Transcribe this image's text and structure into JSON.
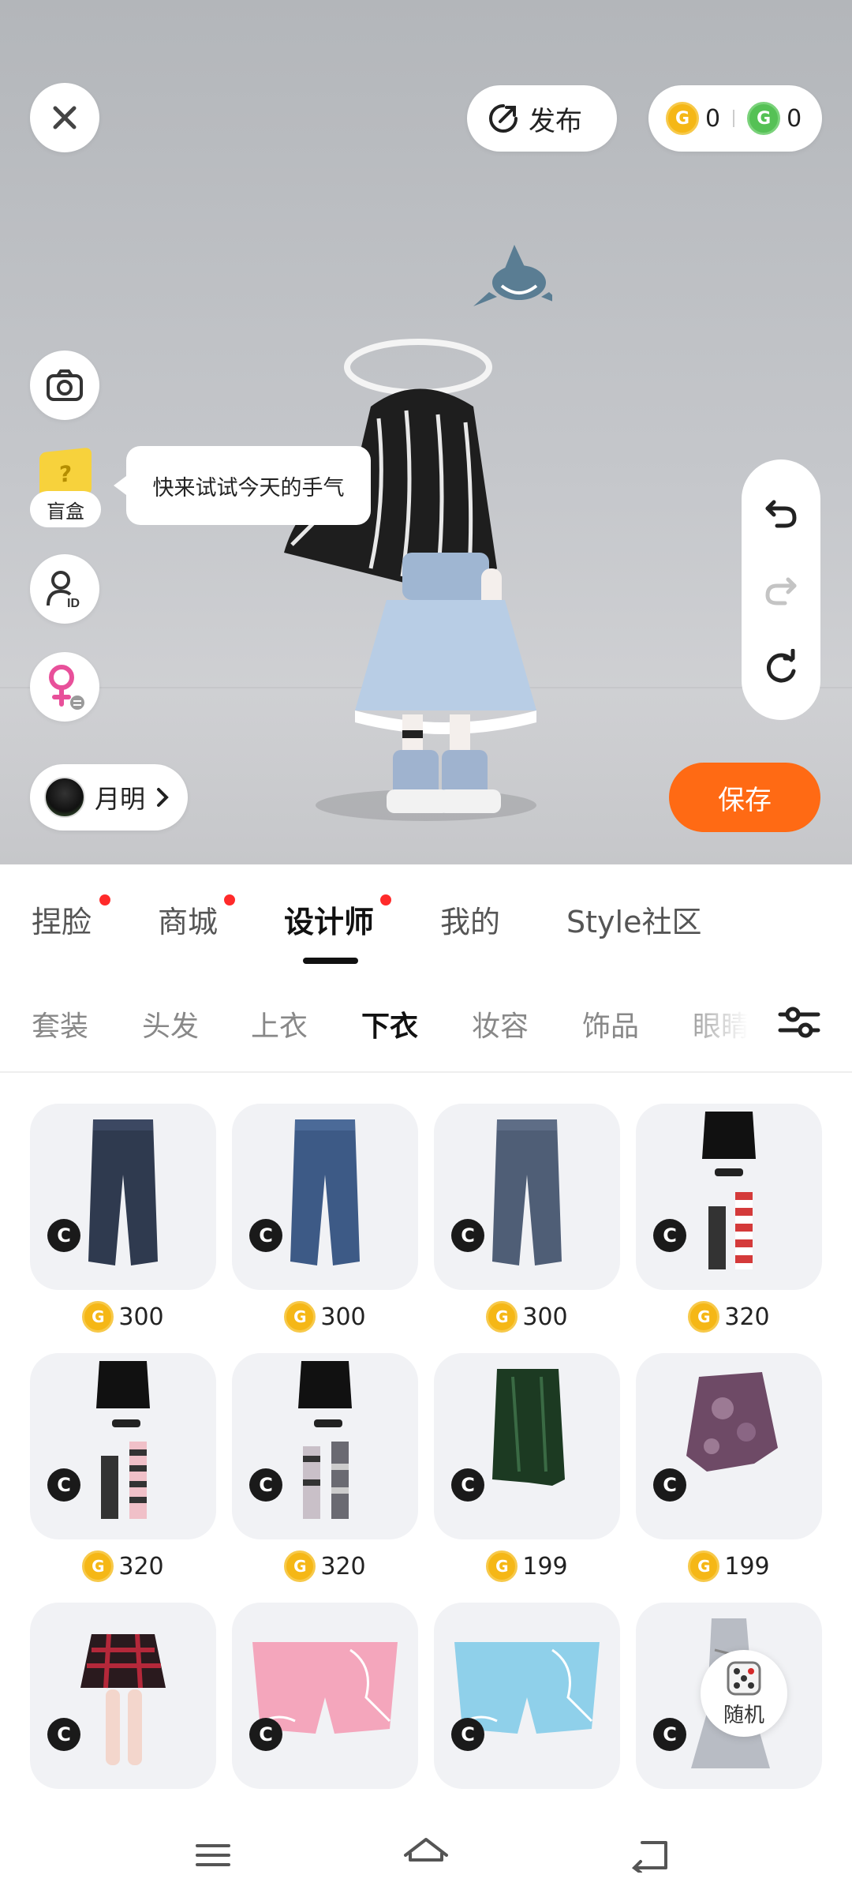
{
  "top_bar": {
    "close_icon": "close-icon",
    "publish_label": "发布",
    "gold_coins": "0",
    "green_coins": "0"
  },
  "left_tools": {
    "blindbox_label": "盲盒",
    "blindbox_tip": "快来试试今天的手气"
  },
  "user": {
    "name": "月明"
  },
  "save_label": "保存",
  "main_tabs": [
    {
      "label": "捏脸",
      "dot": true
    },
    {
      "label": "商城",
      "dot": true
    },
    {
      "label": "设计师",
      "dot": true,
      "active": true
    },
    {
      "label": "我的",
      "dot": false
    },
    {
      "label": "Style社区",
      "dot": false
    }
  ],
  "categories": [
    {
      "label": "套装"
    },
    {
      "label": "头发"
    },
    {
      "label": "上衣"
    },
    {
      "label": "下衣",
      "active": true
    },
    {
      "label": "妆容"
    },
    {
      "label": "饰品"
    },
    {
      "label": "眼睛"
    }
  ],
  "items": [
    {
      "name": "dark-jeans",
      "price": "300"
    },
    {
      "name": "blue-jeans",
      "price": "300"
    },
    {
      "name": "washed-jeans",
      "price": "300"
    },
    {
      "name": "black-skirt-red-socks",
      "price": "320"
    },
    {
      "name": "black-skirt-pink-socks",
      "price": "320"
    },
    {
      "name": "black-skirt-gray-socks",
      "price": "320"
    },
    {
      "name": "green-leather-skirt",
      "price": "199"
    },
    {
      "name": "purple-tie-dye-skirt",
      "price": "199"
    },
    {
      "name": "red-plaid-mini-skirt",
      "price": ""
    },
    {
      "name": "pink-shorts",
      "price": ""
    },
    {
      "name": "blue-shorts",
      "price": ""
    },
    {
      "name": "gray-long-skirt",
      "price": ""
    }
  ],
  "random_label": "随机",
  "badge_letter": "C",
  "coin_letter": "G",
  "colors": {
    "accent_orange": "#ff6a14",
    "notify_red": "#ff2a2a",
    "coin_gold": "#f5b716",
    "coin_green": "#55c155"
  }
}
